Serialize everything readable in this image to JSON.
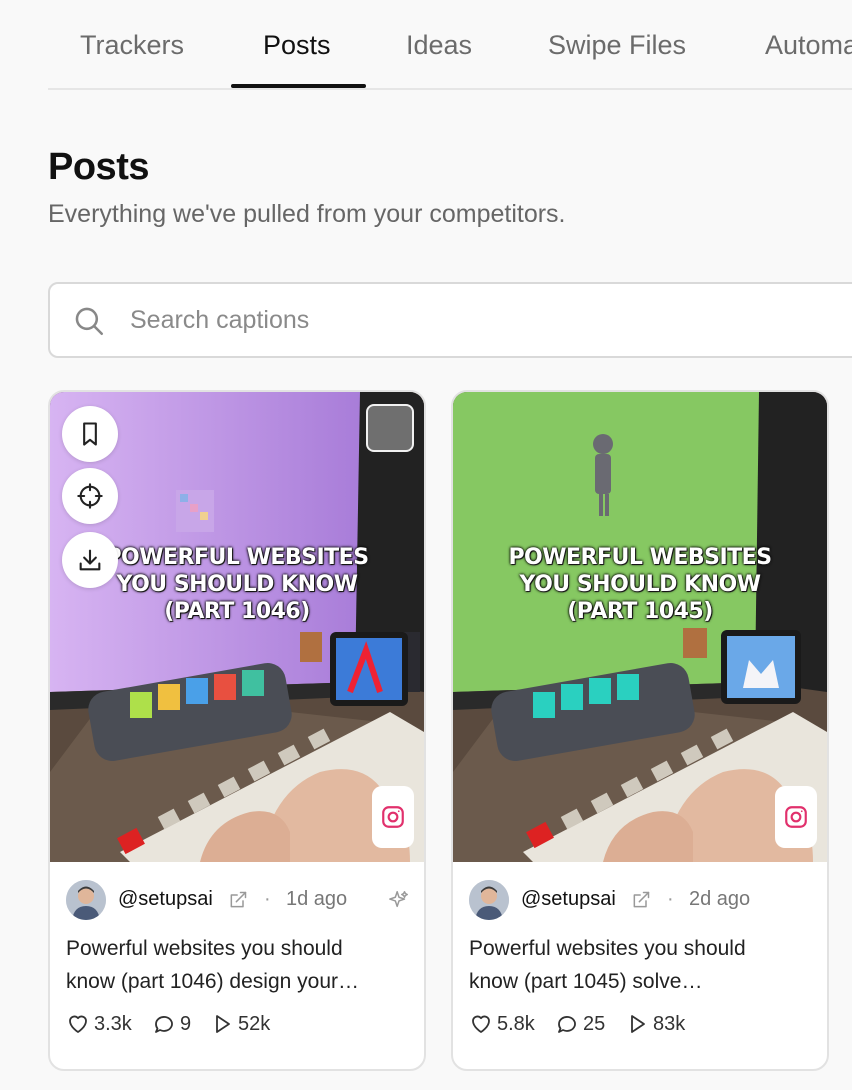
{
  "tabs": [
    {
      "label": "Trackers",
      "active": false
    },
    {
      "label": "Posts",
      "active": true
    },
    {
      "label": "Ideas",
      "active": false
    },
    {
      "label": "Swipe Files",
      "active": false
    },
    {
      "label": "Automa",
      "active": false
    }
  ],
  "page": {
    "title": "Posts",
    "subtitle": "Everything we've pulled from your competitors."
  },
  "search": {
    "placeholder": "Search captions",
    "value": ""
  },
  "icons": {
    "search": "search-icon",
    "bookmark": "bookmark-icon",
    "target": "crosshair-icon",
    "download": "download-icon",
    "platform": "instagram-icon",
    "external": "external-link-icon",
    "sparkle": "sparkle-icon",
    "likes": "heart-icon",
    "comments": "comment-icon",
    "views": "play-icon"
  },
  "colors": {
    "instagram": "#e1306c",
    "card1_bg": "#c89ae8",
    "card2_bg": "#7cc95a"
  },
  "posts": [
    {
      "overlay_lines": [
        "POWERFUL WEBSITES",
        "YOU SHOULD KNOW",
        "(PART 1046)"
      ],
      "username": "@setupsai",
      "time_ago": "1d ago",
      "caption_lines": [
        "Powerful websites you should",
        "know (part 1046) design your…"
      ],
      "likes": "3.3k",
      "comments": "9",
      "views": "52k"
    },
    {
      "overlay_lines": [
        "POWERFUL WEBSITES",
        "YOU SHOULD KNOW",
        "(PART 1045)"
      ],
      "username": "@setupsai",
      "time_ago": "2d ago",
      "caption_lines": [
        "Powerful websites you should",
        "know (part 1045) solve…"
      ],
      "likes": "5.8k",
      "comments": "25",
      "views": "83k"
    }
  ],
  "separator": "·"
}
